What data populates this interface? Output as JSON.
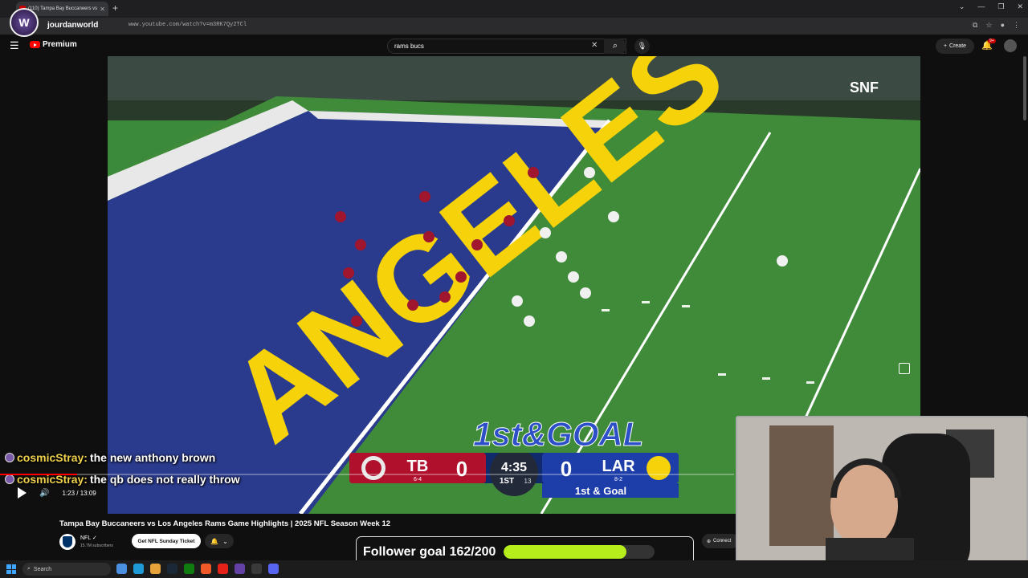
{
  "browser": {
    "tab_title": "(110) Tampa Bay Buccaneers vs",
    "url": "www.youtube.com/watch?v=m3RK7Qy2TCl",
    "channel": "jourdanworld"
  },
  "youtube": {
    "logo_text": "Premium",
    "search_value": "rams bucs",
    "create_label": "Create",
    "notif_count": "9+"
  },
  "video": {
    "title": "Tampa Bay Buccaneers vs Los Angeles Rams Game Highlights | 2025 NFL Season Week 12",
    "time": "1:23 / 13:09",
    "progress": 0.105,
    "network_logo": "SNF",
    "field_text": "ANGELES",
    "down_graphic": "1st&GOAL"
  },
  "scorebug": {
    "team1": "TB",
    "team1_record": "6-4",
    "team1_score": "0",
    "team2": "LAR",
    "team2_record": "8-2",
    "team2_score": "0",
    "clock": "4:35",
    "quarter": "1ST",
    "playclock": "13",
    "situation": "1st & Goal"
  },
  "channel_info": {
    "name": "NFL",
    "subscribers": "15.7M subscribers",
    "ticket_label": "Get NFL Sunday Ticket",
    "connect_label": "Connect"
  },
  "chat": [
    {
      "user": "cosmicStray:",
      "message": "the new anthony brown"
    },
    {
      "user": "cosmicStray:",
      "message": "the qb does not really throw"
    }
  ],
  "goal": {
    "label": "Follower goal 162/200",
    "fraction": 0.81
  },
  "taskbar": {
    "search_placeholder": "Search"
  },
  "colors": {
    "youtube_red": "#ff0000",
    "goal_fill": "#b5ee1a",
    "chat_name": "#f0d14c"
  }
}
